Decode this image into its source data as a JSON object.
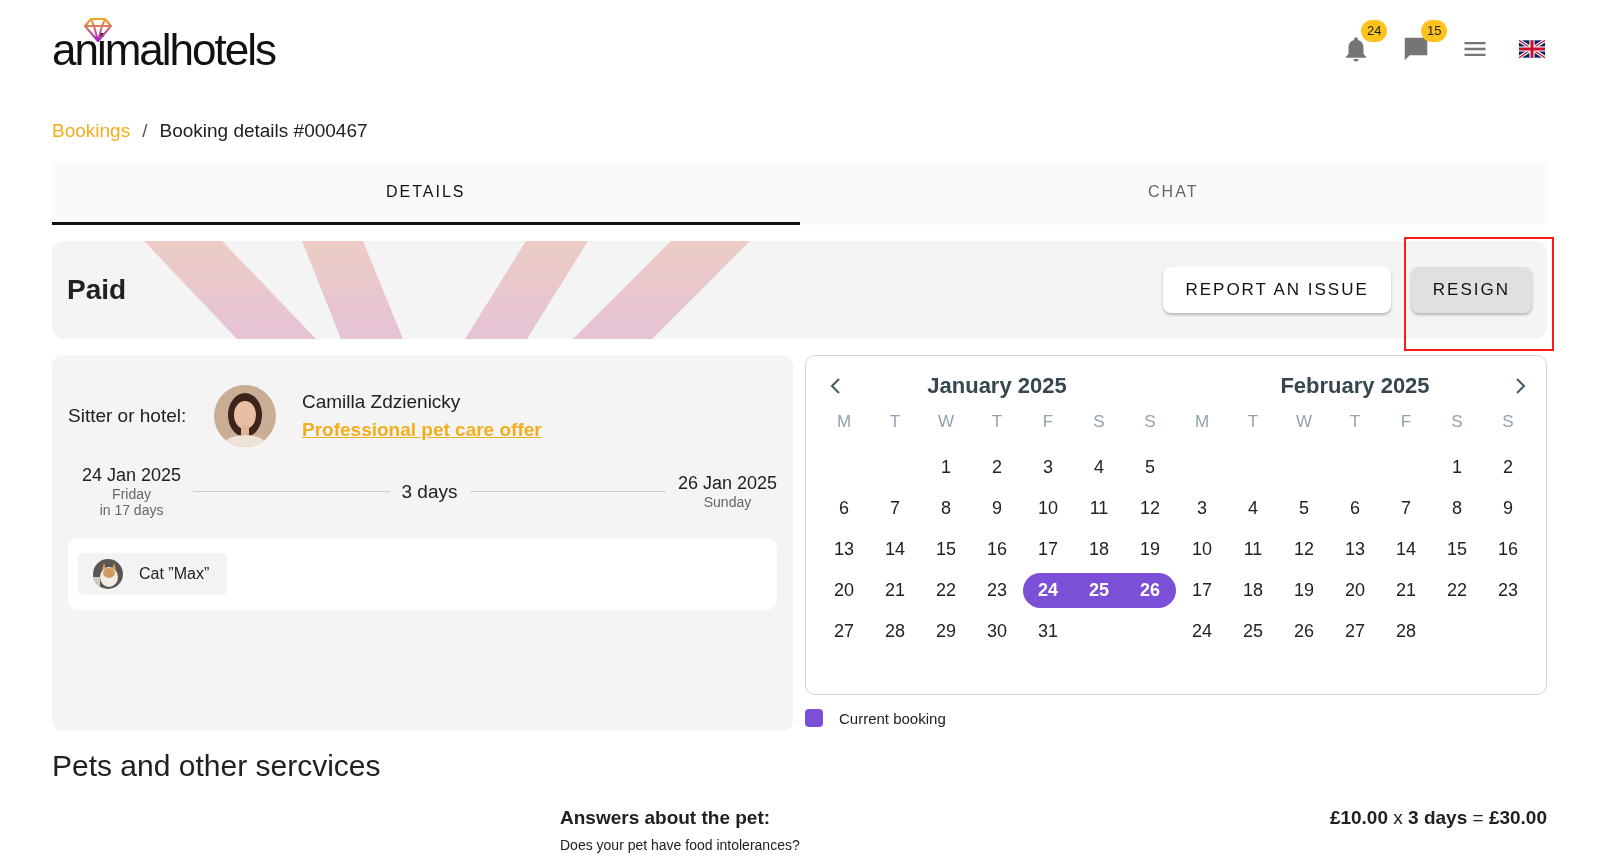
{
  "header": {
    "logo": "animalhotels",
    "notifications": {
      "count": "24"
    },
    "messages": {
      "count": "15"
    }
  },
  "breadcrumb": {
    "separator": "/",
    "items": [
      {
        "label": "Bookings",
        "kind": "link"
      },
      {
        "label": "Booking details #000467",
        "kind": "current"
      }
    ]
  },
  "tabs": [
    {
      "label": "DETAILS",
      "selected": true
    },
    {
      "label": "CHAT",
      "selected": false
    }
  ],
  "status": {
    "label": "Paid",
    "buttons": [
      {
        "label": "REPORT AN ISSUE",
        "kind": "outlined"
      },
      {
        "label": "RESIGN",
        "kind": "tonal"
      }
    ]
  },
  "booking": {
    "sitter_label": "Sitter or hotel:",
    "sitter_name": "Camilla Zdzienicky",
    "offer_link": "Professional pet care offer",
    "start": {
      "date": "24 Jan 2025",
      "weekday": "Friday",
      "relative": "in 17 days"
    },
    "duration": "3 days",
    "end": {
      "date": "26 Jan 2025",
      "weekday": "Sunday"
    },
    "pets": [
      {
        "name": "Cat ”Max”"
      }
    ]
  },
  "calendar": {
    "months": [
      {
        "title": "January 2025",
        "weekdays": [
          "M",
          "T",
          "W",
          "T",
          "F",
          "S",
          "S"
        ],
        "weeks": [
          [
            {
              "day": "1",
              "selected": false
            },
            {
              "day": "2",
              "selected": false
            },
            {
              "day": "3",
              "selected": false
            },
            {
              "day": "4",
              "selected": false
            },
            {
              "day": "5",
              "selected": false
            }
          ],
          [
            {
              "day": "6",
              "selected": false
            },
            {
              "day": "7",
              "selected": false
            },
            {
              "day": "8",
              "selected": false
            },
            {
              "day": "9",
              "selected": false
            },
            {
              "day": "10",
              "selected": false
            },
            {
              "day": "11",
              "selected": false
            },
            {
              "day": "12",
              "selected": false
            }
          ],
          [
            {
              "day": "13",
              "selected": false
            },
            {
              "day": "14",
              "selected": false
            },
            {
              "day": "15",
              "selected": false
            },
            {
              "day": "16",
              "selected": false
            },
            {
              "day": "17",
              "selected": false
            },
            {
              "day": "18",
              "selected": false
            },
            {
              "day": "19",
              "selected": false
            }
          ],
          [
            {
              "day": "20",
              "selected": false
            },
            {
              "day": "21",
              "selected": false
            },
            {
              "day": "22",
              "selected": false
            },
            {
              "day": "23",
              "selected": false
            },
            {
              "day": "24",
              "selected": true
            },
            {
              "day": "25",
              "selected": true
            },
            {
              "day": "26",
              "selected": true
            }
          ],
          [
            {
              "day": "27",
              "selected": false
            },
            {
              "day": "28",
              "selected": false
            },
            {
              "day": "29",
              "selected": false
            },
            {
              "day": "30",
              "selected": false
            },
            {
              "day": "31",
              "selected": false
            }
          ]
        ]
      },
      {
        "title": "February 2025",
        "weekdays": [
          "M",
          "T",
          "W",
          "T",
          "F",
          "S",
          "S"
        ],
        "weeks": [
          [
            {
              "day": "1",
              "selected": false
            },
            {
              "day": "2",
              "selected": false
            }
          ],
          [
            {
              "day": "3",
              "selected": false
            },
            {
              "day": "4",
              "selected": false
            },
            {
              "day": "5",
              "selected": false
            },
            {
              "day": "6",
              "selected": false
            },
            {
              "day": "7",
              "selected": false
            },
            {
              "day": "8",
              "selected": false
            },
            {
              "day": "9",
              "selected": false
            }
          ],
          [
            {
              "day": "10",
              "selected": false
            },
            {
              "day": "11",
              "selected": false
            },
            {
              "day": "12",
              "selected": false
            },
            {
              "day": "13",
              "selected": false
            },
            {
              "day": "14",
              "selected": false
            },
            {
              "day": "15",
              "selected": false
            },
            {
              "day": "16",
              "selected": false
            }
          ],
          [
            {
              "day": "17",
              "selected": false
            },
            {
              "day": "18",
              "selected": false
            },
            {
              "day": "19",
              "selected": false
            },
            {
              "day": "20",
              "selected": false
            },
            {
              "day": "21",
              "selected": false
            },
            {
              "day": "22",
              "selected": false
            },
            {
              "day": "23",
              "selected": false
            }
          ],
          [
            {
              "day": "24",
              "selected": false
            },
            {
              "day": "25",
              "selected": false
            },
            {
              "day": "26",
              "selected": false
            },
            {
              "day": "27",
              "selected": false
            },
            {
              "day": "28",
              "selected": false
            }
          ]
        ]
      }
    ],
    "legend": [
      {
        "label": "Current booking",
        "color": "#7b4fd6"
      }
    ]
  },
  "services": {
    "heading": "Pets and other sercvices",
    "answers_title": "Answers about the pet:",
    "price": "**£10.00** x **3 days** = **£30.00**",
    "question": "Does your pet have food intolerances?"
  }
}
